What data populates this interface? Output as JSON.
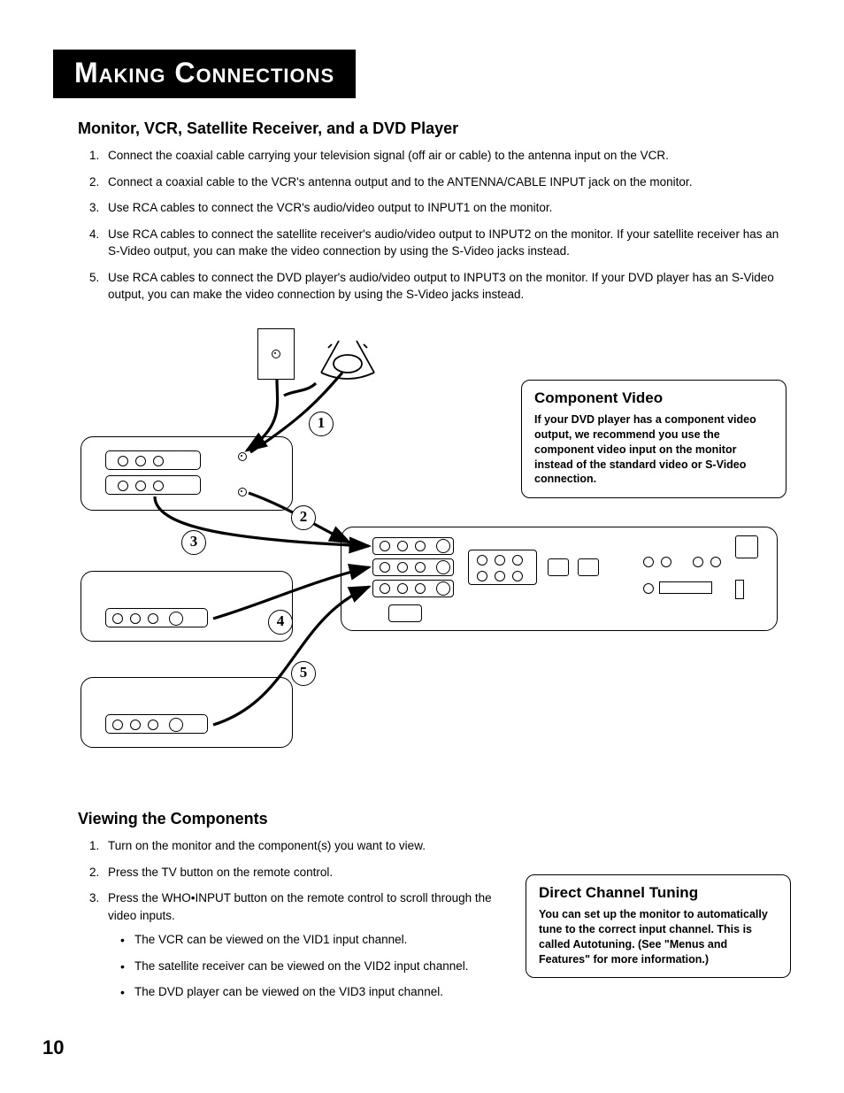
{
  "header": {
    "title": "Making Connections"
  },
  "section1": {
    "heading": "Monitor, VCR, Satellite Receiver, and a DVD Player",
    "steps": [
      "Connect the coaxial cable carrying your television signal (off air or cable) to the antenna input on the VCR.",
      "Connect a coaxial cable to the VCR's antenna output and to the ANTENNA/CABLE INPUT jack on the monitor.",
      "Use RCA cables to connect the VCR's audio/video output to INPUT1 on the monitor.",
      "Use RCA cables to connect the satellite receiver's audio/video output to INPUT2 on the monitor. If your satellite receiver has an S-Video output, you can make the video connection by using the S-Video jacks instead.",
      "Use RCA cables to connect the DVD player's audio/video output to INPUT3 on the monitor. If your DVD player has an S-Video output, you can make the video connection by using the S-Video jacks instead."
    ]
  },
  "calloutA": {
    "title": "Component Video",
    "body": "If your DVD player has a component video output, we recommend you use the component video input on the monitor instead of the standard video or S-Video connection."
  },
  "diagram": {
    "labels": {
      "1": "1",
      "2": "2",
      "3": "3",
      "4": "4",
      "5": "5"
    }
  },
  "section2": {
    "heading": "Viewing the Components",
    "steps": [
      "Turn on the monitor and the component(s) you want to view.",
      "Press the TV button on the remote control.",
      "Press the WHO•INPUT button on the remote control to scroll through the video inputs."
    ],
    "bullets": [
      "The VCR can be viewed on the VID1 input channel.",
      "The satellite receiver can be viewed on the VID2 input channel.",
      "The DVD player can be viewed on the VID3 input channel."
    ]
  },
  "calloutB": {
    "title": "Direct Channel Tuning",
    "body": "You can set up the monitor to automatically tune to the correct input channel. This is called Autotuning. (See \"Menus and Features\" for more information.)"
  },
  "page_number": "10"
}
